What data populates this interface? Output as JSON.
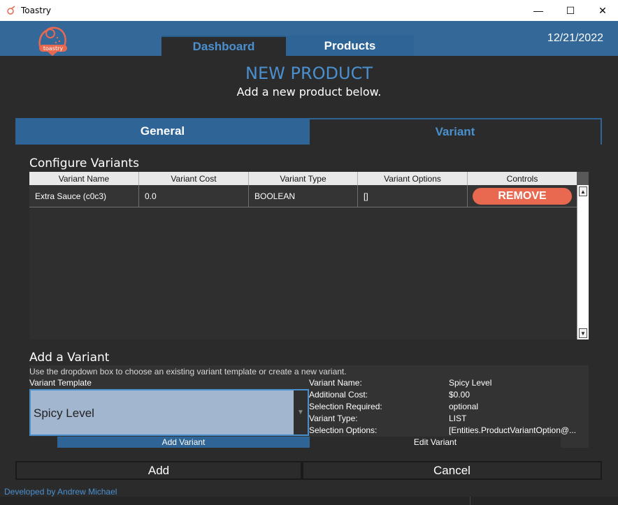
{
  "window": {
    "title": "Toastry",
    "icon": "toast-icon",
    "controls": {
      "minimize": "—",
      "maximize": "☐",
      "close": "✕"
    }
  },
  "header": {
    "logo_text": "toastry",
    "date": "12/21/2022",
    "tabs": [
      {
        "label": "Dashboard",
        "active": true
      },
      {
        "label": "Products",
        "active": false
      }
    ]
  },
  "page": {
    "title": "NEW PRODUCT",
    "subtitle": "Add a new product below."
  },
  "section_tabs": [
    {
      "label": "General",
      "active": false
    },
    {
      "label": "Variant",
      "active": true
    }
  ],
  "configure": {
    "heading": "Configure Variants",
    "columns": [
      "Variant Name",
      "Variant Cost",
      "Variant Type",
      "Variant Options",
      "Controls"
    ],
    "rows": [
      {
        "name": "Extra Sauce (c0c3)",
        "cost": "0.0",
        "type": "BOOLEAN",
        "options": "[]",
        "control": "REMOVE"
      }
    ]
  },
  "add_variant": {
    "heading": "Add a Variant",
    "helper": "Use the dropdown box to choose an existing variant template or create a new variant.",
    "template_label": "Variant Template",
    "template_value": "Spicy Level",
    "info": [
      {
        "key": "Variant Name:",
        "value": "Spicy Level"
      },
      {
        "key": "Additional Cost:",
        "value": "$0.00"
      },
      {
        "key": "Selection Required:",
        "value": "optional"
      },
      {
        "key": "Variant Type:",
        "value": "LIST"
      },
      {
        "key": "Selection Options:",
        "value": "[Entities.ProductVariantOption@..."
      }
    ],
    "add_button": "Add Variant",
    "edit_button": "Edit Variant"
  },
  "actions": {
    "add": "Add",
    "cancel": "Cancel"
  },
  "footer": {
    "credit": "Developed by Andrew Michael"
  },
  "colors": {
    "accent": "#4a90cf",
    "header": "#346898",
    "remove": "#e8694f",
    "background": "#2b2b2b"
  }
}
